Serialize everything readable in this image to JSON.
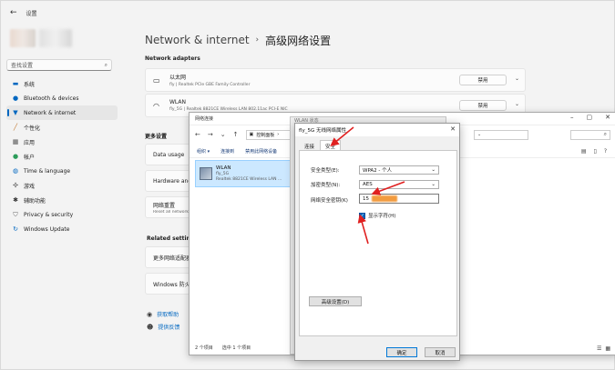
{
  "settings": {
    "app_title": "设置",
    "search_placeholder": "查找设置",
    "nav": [
      {
        "label": "系统",
        "icon": "system-icon"
      },
      {
        "label": "Bluetooth & devices",
        "icon": "bluetooth-icon"
      },
      {
        "label": "Network & internet",
        "icon": "wifi-icon"
      },
      {
        "label": "个性化",
        "icon": "brush-icon"
      },
      {
        "label": "应用",
        "icon": "apps-icon"
      },
      {
        "label": "帐户",
        "icon": "person-icon"
      },
      {
        "label": "Time & language",
        "icon": "globe-icon"
      },
      {
        "label": "游戏",
        "icon": "game-icon"
      },
      {
        "label": "辅助功能",
        "icon": "accessibility-icon"
      },
      {
        "label": "Privacy & security",
        "icon": "shield-icon"
      },
      {
        "label": "Windows Update",
        "icon": "update-icon"
      }
    ],
    "breadcrumb_parent": "Network & internet",
    "breadcrumb_sep": "›",
    "breadcrumb_current": "高级网络设置",
    "adapters_heading": "Network adapters",
    "adapters": [
      {
        "name": "以太网",
        "desc": "fly | Realtek PCIe GBE Family Controller",
        "button": "禁用"
      },
      {
        "name": "WLAN",
        "desc": "fly_5G | Realtek 8821CE Wireless LAN 802.11ac PCI-E NIC",
        "button": "禁用"
      }
    ],
    "more_heading": "更多设置",
    "more_rows": [
      {
        "title": "Data usage",
        "sub": ""
      },
      {
        "title": "Hardware and c",
        "sub": ""
      },
      {
        "title": "网络重置",
        "sub": "Reset all network"
      }
    ],
    "related_heading": "Related settings",
    "related_rows": [
      {
        "title": "更多网络适配器"
      },
      {
        "title": "Windows 防火墙"
      }
    ],
    "help_links": [
      "获取帮助",
      "提供反馈"
    ]
  },
  "control_panel": {
    "title": "网络连接",
    "address": "控制面板",
    "toolbar": [
      "组织 ▾",
      "连接到",
      "禁用此网络设备"
    ],
    "item": {
      "name": "WLAN",
      "ssid": "fly_5G",
      "adapter": "Realtek 8821CE Wireless LAN ..."
    },
    "status_count": "2 个项目",
    "status_selected": "选中 1 个项目"
  },
  "status_window": {
    "title": "WLAN 状态"
  },
  "properties": {
    "title": "fly_5G 无线网络属性",
    "tabs": [
      "连接",
      "安全"
    ],
    "security_type_label": "安全类型(E):",
    "security_type_value": "WPA2 - 个人",
    "encryption_label": "加密类型(N):",
    "encryption_value": "AES",
    "key_label": "网络安全密钥(K)",
    "key_prefix": "15",
    "show_chars_label": "显示字符(H)",
    "advanced_button": "高级设置(D)",
    "ok_button": "确定",
    "cancel_button": "取消"
  },
  "colors": {
    "accent": "#0067c0",
    "arrow": "#e02020",
    "password_blur": "#f29b3e"
  }
}
